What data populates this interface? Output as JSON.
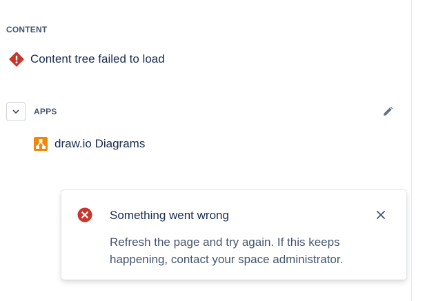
{
  "sidebar": {
    "content_heading": "CONTENT",
    "content_error": "Content tree failed to load",
    "apps_heading": "APPS",
    "apps": [
      {
        "label": "draw.io Diagrams",
        "icon": "drawio-icon"
      }
    ]
  },
  "flag": {
    "title": "Something went wrong",
    "message": "Refresh the page and try again. If this keeps happening, contact your space administrator."
  },
  "colors": {
    "error": "#c9372c",
    "drawio": "#f08705",
    "heading": "#44546f",
    "text": "#172b4d"
  },
  "icons": {
    "content_error": "warning-diamond-icon",
    "apps_toggle": "chevron-down-icon",
    "apps_edit": "pencil-icon",
    "flag_error": "error-circle-icon",
    "flag_close": "close-icon"
  }
}
